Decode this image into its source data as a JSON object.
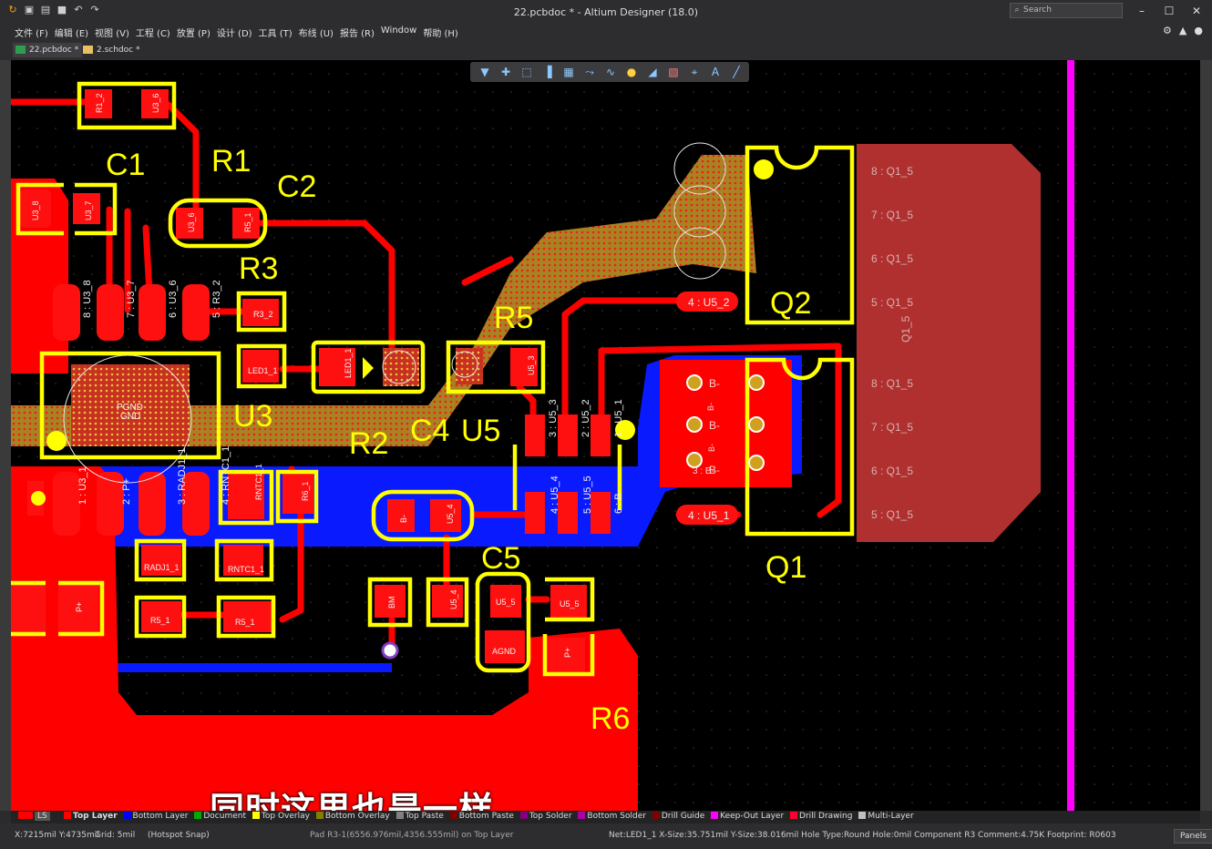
{
  "window": {
    "title": "22.pcbdoc * - Altium Designer (18.0)",
    "search_placeholder": "Search",
    "controls": {
      "minimize": "–",
      "maximize": "☐",
      "close": "✕"
    }
  },
  "quick_access": [
    "save-icon",
    "save-all-icon",
    "open-icon",
    "undo-icon",
    "redo-icon"
  ],
  "menu": {
    "items": [
      "文件 (F)",
      "编辑 (E)",
      "视图 (V)",
      "工程 (C)",
      "放置 (P)",
      "设计 (D)",
      "工具 (T)",
      "布线 (U)",
      "报告 (R)",
      "Window",
      "帮助 (H)"
    ],
    "right_icons": [
      "gear-icon",
      "bell-icon",
      "user-icon"
    ]
  },
  "tabs": [
    {
      "label": "22.pcbdoc *",
      "active": true
    },
    {
      "label": "2.schdoc *",
      "active": false
    }
  ],
  "toolbox_icons": [
    "filter-icon",
    "cross-icon",
    "select-rect-icon",
    "chart-icon",
    "chip-icon",
    "route-icon",
    "diff-pair-icon",
    "via-icon",
    "polygon-icon",
    "dimension-icon",
    "component-icon",
    "text-icon",
    "line-icon"
  ],
  "pcb": {
    "designators": {
      "C1": "C1",
      "R1": "R1",
      "C2": "C2",
      "R3": "R3",
      "R5": "R5",
      "U3": "U3",
      "R2": "R2",
      "C4": "C4",
      "U5": "U5",
      "C5": "C5",
      "Q2": "Q2",
      "Q1": "Q1",
      "RADJ1": "RADJ1",
      "RNTC1": "RNTC1",
      "R6": "R6"
    },
    "pads": {
      "r12": "R1_2",
      "u36a": "U3_6",
      "u38a": "U3_8",
      "u37a": "U3_7",
      "u36b": "U3_6",
      "r51a": "R5_1",
      "u38b": "8 : U3_8",
      "u37b": "7 : U3_7",
      "u36c": "6 : U3_6",
      "r32a": "5 : R3_2",
      "r32b": "R3_2",
      "led11a": "LED1_1",
      "led11b": "LED1_1",
      "u53a": "U5_3",
      "u31": "1 : U3_1",
      "pplus": "2 : P+",
      "radj11a": "3 : RADJ1_1",
      "rntc11a": "4 : RNTC1_1",
      "rntc11b": "RNTC1_1",
      "r61": "R6_1",
      "radj11b": "RADJ1_1",
      "rntc11c": "RNTC1_1",
      "r51b": "R5_1",
      "r51c": "R5_1",
      "u53b": "3 : U5_3",
      "u52": "2 : U5_2",
      "u51": "1 : U5_1",
      "u54a": "4 : U5_4",
      "u55a": "5 : U5_5",
      "b6": "6 : B-",
      "bl": "B-",
      "u54b": "U5_4",
      "bm": "BM",
      "u54c": "U5_4",
      "u55b": "U5_5",
      "u55c": "U5_5",
      "agnd": "AGND",
      "pplus2": "P+",
      "pplus3": "P+",
      "gnd": "GND",
      "pgnd": "PGND",
      "label4u52": "4 : U5_2",
      "label4u51": "4 : U5_1",
      "q2pins": [
        "8 : Q1_5",
        "7 : Q1_5",
        "6 : Q1_5",
        "5 : Q1_5"
      ],
      "q1pins": [
        "8 : Q1_5",
        "7 : Q1_5",
        "6 : Q1_5",
        "5 : Q1_5"
      ],
      "q15": "Q1_5",
      "bminus": [
        "B-",
        "B-",
        "B-"
      ],
      "bsmall": [
        "B-",
        "B-",
        "3 : B-"
      ]
    }
  },
  "layers": {
    "ls": "LS",
    "items": [
      {
        "name": "Top Layer",
        "color": "#ff0000"
      },
      {
        "name": "Bottom Layer",
        "color": "#0000ff"
      },
      {
        "name": "Document",
        "color": "#00aa00"
      },
      {
        "name": "Top Overlay",
        "color": "#ffff00"
      },
      {
        "name": "Bottom Overlay",
        "color": "#808000"
      },
      {
        "name": "Top Paste",
        "color": "#808080"
      },
      {
        "name": "Bottom Paste",
        "color": "#800000"
      },
      {
        "name": "Top Solder",
        "color": "#800080"
      },
      {
        "name": "Bottom Solder",
        "color": "#aa00aa"
      },
      {
        "name": "Drill Guide",
        "color": "#800000"
      },
      {
        "name": "Keep-Out Layer",
        "color": "#ff00ff"
      },
      {
        "name": "Drill Drawing",
        "color": "#ff002a"
      },
      {
        "name": "Multi-Layer",
        "color": "#c0c0c0"
      }
    ]
  },
  "caption": "同时这里也是一样",
  "status": {
    "coords": "X:7215mil Y:4735mil",
    "grid": "Grid: 5mil",
    "snap": "(Hotspot Snap)",
    "pad_info": "Pad R3-1(6556.976mil,4356.555mil) on Top Layer",
    "net_info": "Net:LED1_1 X-Size:35.751mil Y-Size:38.016mil Hole Type:Round Hole:0mil   Component R3 Comment:4.75K Footprint: R0603",
    "panels": "Panels"
  }
}
